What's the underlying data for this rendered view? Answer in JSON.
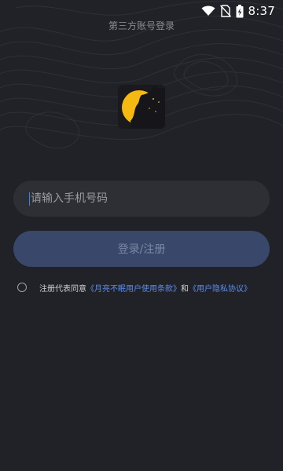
{
  "status_bar": {
    "time": "8:37",
    "icons": [
      "wifi-icon",
      "no-sim-icon",
      "battery-charging-icon"
    ]
  },
  "header": {
    "title": "第三方账号登录"
  },
  "logo": {
    "icon": "moon-cat-logo",
    "colors": {
      "moon": "#f5b912",
      "background": "#1a1a1e"
    }
  },
  "phone_input": {
    "placeholder": "请输入手机号码",
    "value": ""
  },
  "login_button": {
    "label": "登录/注册"
  },
  "agreement": {
    "prefix": "注册代表同意",
    "terms_link": "《月亮不眠用户使用条款》",
    "conjunction": "和",
    "privacy_link": "《用户隐私协议》"
  },
  "colors": {
    "background": "#212227",
    "input_bg": "#2d2f35",
    "button_bg": "#38476a",
    "link": "#5b8def"
  }
}
